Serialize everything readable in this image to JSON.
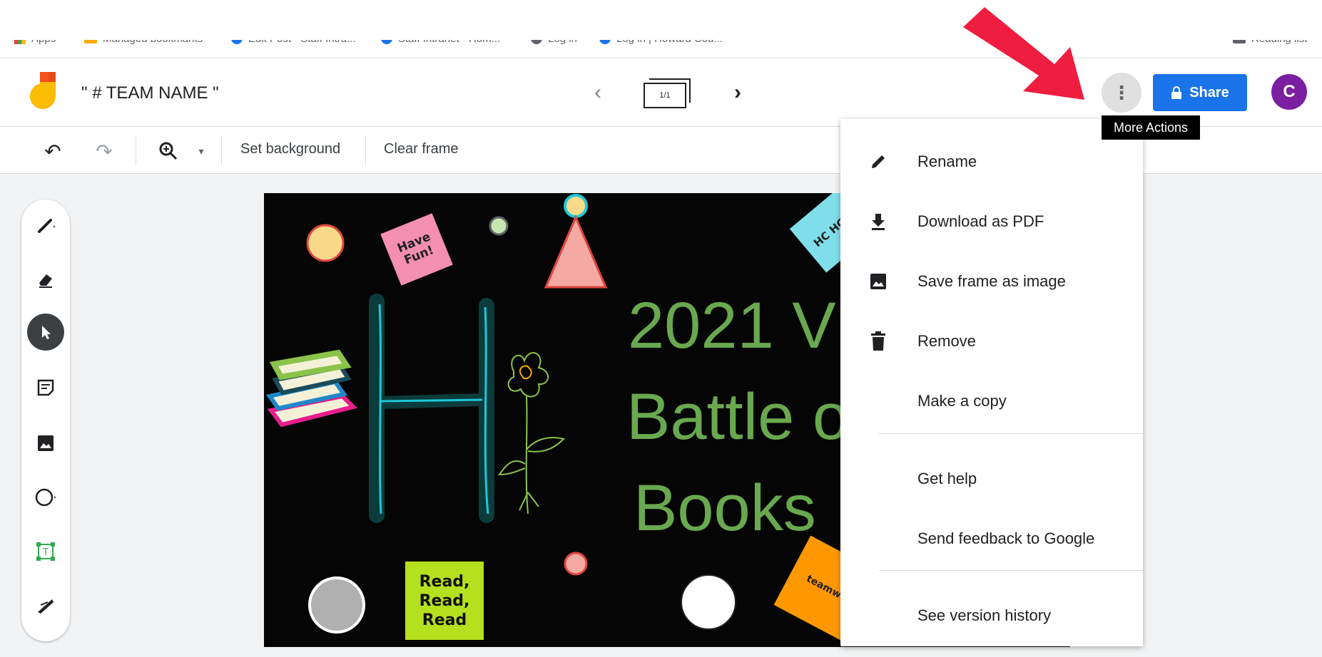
{
  "bookmarks": [
    "Apps",
    "Managed bookmarks",
    "Edit Post · Staff Intra...",
    "Staff Intranet - Hom...",
    "Log in",
    "Log in | Howard Cou...",
    "Reading list"
  ],
  "header": {
    "title": "\" # TEAM NAME \"",
    "frame_counter": "1/1",
    "share_label": "Share",
    "avatar_initial": "C",
    "tooltip": "More Actions"
  },
  "toolbar": {
    "set_background": "Set background",
    "clear_frame": "Clear frame"
  },
  "board": {
    "sticky_have_fun": "Have Fun!",
    "sticky_read": [
      "Read,",
      "Read,",
      "Read"
    ],
    "sticky_hoco": "HC HCP",
    "sticky_teamwork": "teamwo",
    "headline": [
      "2021 V",
      "Battle o",
      "Books"
    ]
  },
  "menu": {
    "items": [
      {
        "label": "Rename",
        "icon": "pencil-icon"
      },
      {
        "label": "Download as PDF",
        "icon": "download-icon"
      },
      {
        "label": "Save frame as image",
        "icon": "image-icon"
      },
      {
        "label": "Remove",
        "icon": "trash-icon"
      },
      {
        "label": "Make a copy",
        "icon": ""
      },
      {
        "label": "Get help",
        "icon": ""
      },
      {
        "label": "Send feedback to Google",
        "icon": ""
      },
      {
        "label": "See version history",
        "icon": ""
      }
    ]
  },
  "colors": {
    "accent": "#1a73e8",
    "avatar": "#7b1fa2",
    "annotation_arrow": "#ef1d3f",
    "headline": "#6aa84f"
  }
}
